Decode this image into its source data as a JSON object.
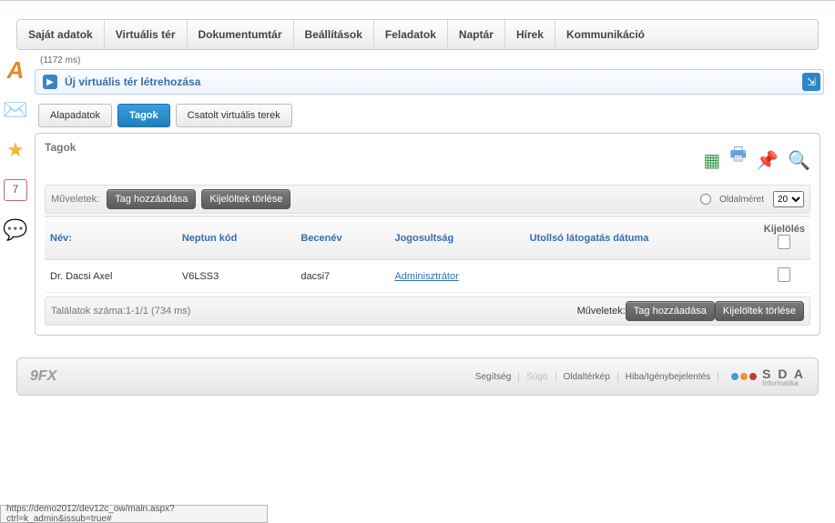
{
  "menu": [
    "Saját adatok",
    "Virtuális tér",
    "Dokumentumtár",
    "Beállítások",
    "Feladatok",
    "Naptár",
    "Hírek",
    "Kommunikáció"
  ],
  "timing": "(1172 ms)",
  "accordion": {
    "title": "Új virtuális tér létrehozása"
  },
  "tabs": [
    {
      "label": "Alapadatok",
      "active": false
    },
    {
      "label": "Tagok",
      "active": true
    },
    {
      "label": "Csatolt virtuális terek",
      "active": false
    }
  ],
  "panel": {
    "title": "Tagok"
  },
  "toolbar": {
    "ops_label": "Műveletek:",
    "add_label": "Tag hozzáadása",
    "del_label": "Kijelöltek törlése",
    "pagesize_label": "Oldalméret",
    "pagesize_value": "20"
  },
  "table": {
    "headers": {
      "name": "Név:",
      "code": "Neptun kód",
      "nick": "Becenév",
      "role": "Jogosultság",
      "last": "Utollsó látogatás dátuma",
      "select": "Kijelölés"
    },
    "rows": [
      {
        "name": "Dr. Dacsi Axel",
        "code": "V6LSS3",
        "nick": "dacsi7",
        "role": "Adminisztrátor",
        "last": ""
      }
    ],
    "footer": {
      "info": "Találatok száma:1-1/1 (734 ms)",
      "ops_label": "Műveletek:",
      "add_label": "Tag hozzáadása",
      "del_label": "Kijelöltek törlése"
    }
  },
  "footer_links": {
    "help": "Segítség",
    "help2": "Súgó",
    "sitemap": "Oldaltérkép",
    "bug": "Hiba/Igénybejelentés"
  },
  "brand_left": "9FX",
  "brand_right": {
    "name": "S D A",
    "sub": "Informatika"
  },
  "status_url": "https://demo2012/dev12c_ow/main.aspx?ctrl=k_admin&issub=true#"
}
